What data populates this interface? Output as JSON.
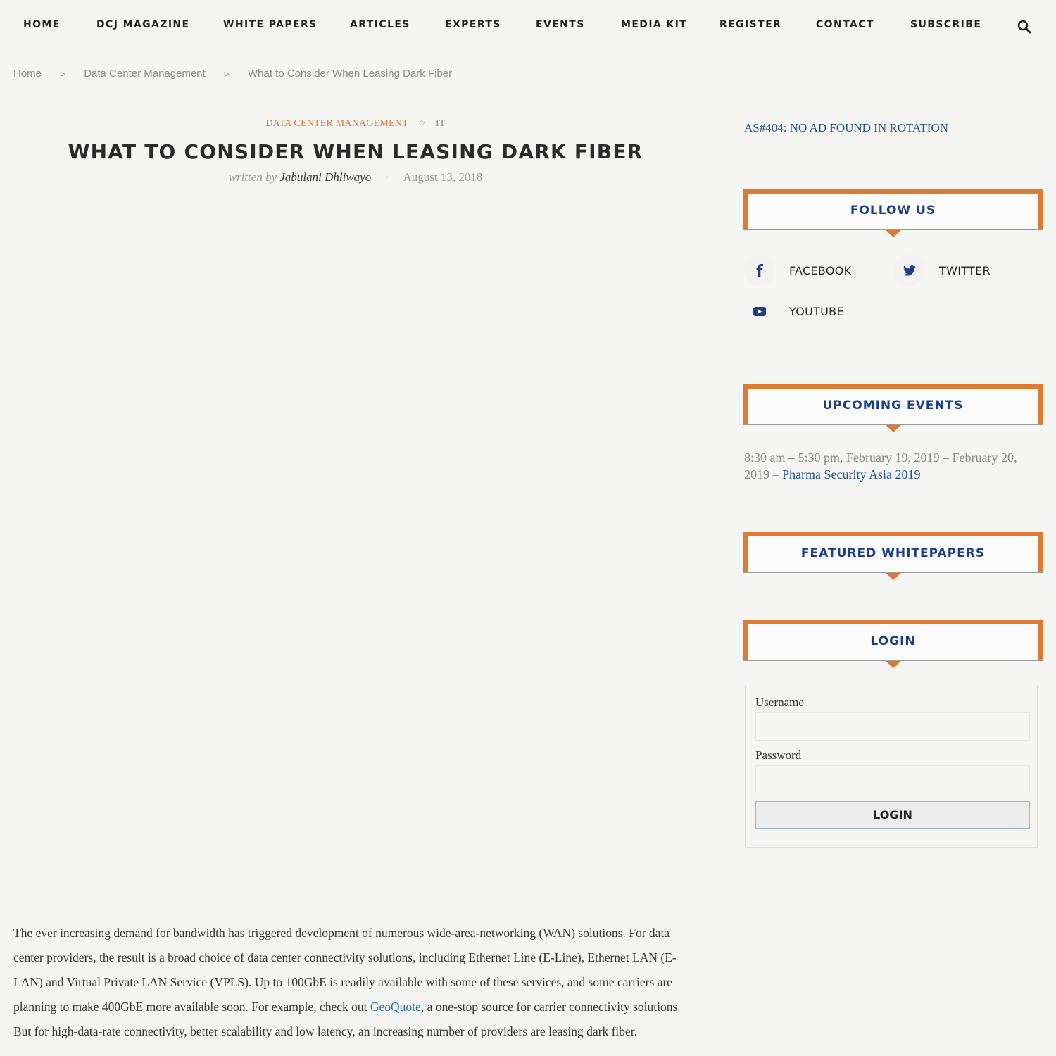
{
  "nav": {
    "items": [
      "HOME",
      "DCJ MAGAZINE",
      "WHITE PAPERS",
      "ARTICLES",
      "EXPERTS",
      "EVENTS",
      "MEDIA KIT",
      "REGISTER",
      "CONTACT",
      "SUBSCRIBE"
    ],
    "search_icon": "search-icon"
  },
  "breadcrumb": {
    "items": [
      "Home",
      "Data Center Management",
      "What to Consider When Leasing Dark Fiber"
    ],
    "separator": ">"
  },
  "article": {
    "categories": [
      "DATA CENTER MANAGEMENT",
      "IT"
    ],
    "category_separator": "◇",
    "title": "WHAT TO CONSIDER WHEN LEASING DARK FIBER",
    "written_by": "written by",
    "author": "Jabulani Dhliwayo",
    "date": "August 13, 2018",
    "body_before_link": "The ever increasing demand for bandwidth has triggered development of numerous wide-area-networking (WAN) solutions. For data center providers, the result is a broad choice of data center connectivity solutions, including Ethernet Line (E-Line), Ethernet LAN (E-LAN) and Virtual Private LAN Service (VPLS). Up to 100GbE is readily available with some of these services, and some carriers are planning to make 400GbE more available soon. For example, check out ",
    "body_link": "GeoQuote",
    "body_after_link": ", a one-stop source for carrier connectivity solutions. But for high-data-rate connectivity, better scalability and low latency, an increasing number of providers are leasing dark fiber."
  },
  "sidebar": {
    "ad_notice": "AS#404: NO AD FOUND IN ROTATION",
    "follow_us": {
      "title": "FOLLOW US",
      "links": [
        {
          "label": "FACEBOOK",
          "icon": "facebook-icon"
        },
        {
          "label": "TWITTER",
          "icon": "twitter-icon"
        },
        {
          "label": "YOUTUBE",
          "icon": "youtube-icon"
        }
      ]
    },
    "upcoming_events": {
      "title": "UPCOMING EVENTS",
      "event_time": "8:30 am – 5:30 pm, February 19, 2019 – February 20, 2019 – ",
      "event_name": "Pharma Security Asia 2019"
    },
    "featured_whitepapers": {
      "title": "FEATURED WHITEPAPERS"
    },
    "login": {
      "title": "LOGIN",
      "username_label": "Username",
      "username_value": "",
      "password_label": "Password",
      "password_value": "",
      "button_label": "LOGIN"
    }
  },
  "colors": {
    "accent_orange": "#e07a2f",
    "link_blue": "#1f4e96",
    "widget_title_blue": "#1c3f8c"
  }
}
